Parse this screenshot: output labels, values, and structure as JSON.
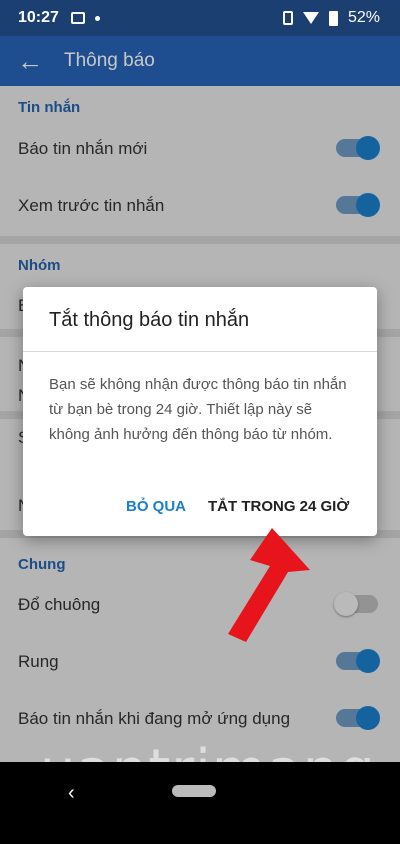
{
  "status_bar": {
    "time": "10:27",
    "battery": "52%"
  },
  "appbar": {
    "title": "Thông báo"
  },
  "sections": {
    "messages": {
      "title": "Tin nhắn",
      "items": [
        {
          "label": "Báo tin nhắn mới",
          "toggle": "on"
        },
        {
          "label": "Xem trước tin nhắn",
          "toggle": "on"
        }
      ]
    },
    "groups": {
      "title": "Nhóm",
      "partial_first_letter": "B"
    },
    "partial_rows": {
      "n1": "N",
      "n2": "N",
      "s": "S",
      "n3": "N"
    },
    "general": {
      "title": "Chung",
      "items": [
        {
          "label": "Đổ chuông",
          "toggle": "off"
        },
        {
          "label": "Rung",
          "toggle": "on"
        },
        {
          "label": "Báo tin nhắn khi đang mở ứng dụng",
          "toggle": "on"
        }
      ]
    }
  },
  "dialog": {
    "title": "Tắt thông báo tin nhắn",
    "message": "Bạn sẽ không nhận được thông báo tin nhắn từ bạn bè trong 24 giờ. Thiết lập này sẽ không ảnh hưởng đến thông báo từ nhóm.",
    "skip_label": "BỎ QUA",
    "confirm_label": "TẮT TRONG 24 GIỜ"
  },
  "watermark": "uantrimang",
  "colors": {
    "accent": "#1b7fcb",
    "appbar": "#2765b8",
    "arrow": "#e8141c"
  },
  "icons": {
    "back": "arrow-left-icon",
    "nav_back": "chevron-left-icon"
  }
}
